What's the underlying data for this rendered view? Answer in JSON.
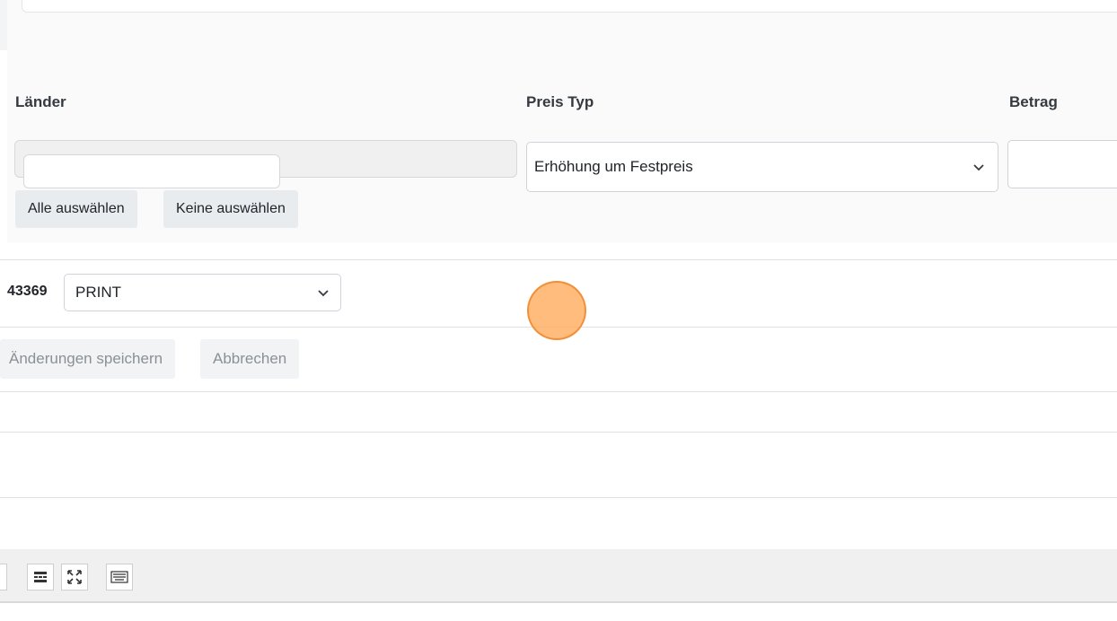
{
  "price_form": {
    "countries_label": "Länder",
    "price_type_label": "Preis Typ",
    "amount_label": "Betrag",
    "countries_search_value": "",
    "select_all_label": "Alle auswählen",
    "select_none_label": "Keine auswählen",
    "price_type_value": "Erhöhung um Festpreis",
    "amount_value": ""
  },
  "order_row": {
    "order_id_fragment": "43369",
    "type_value": "PRINT"
  },
  "actions": {
    "save_label": "Änderungen speichern",
    "cancel_label": "Abbrechen"
  },
  "toolbar": {
    "icons": [
      "partial-icon",
      "horizontal-rule-icon",
      "fullscreen-icon",
      "keyboard-icon"
    ]
  },
  "colors": {
    "cursor": "#ffa550",
    "panel_bg": "#fafafa",
    "button_bg": "#e9ecef"
  }
}
